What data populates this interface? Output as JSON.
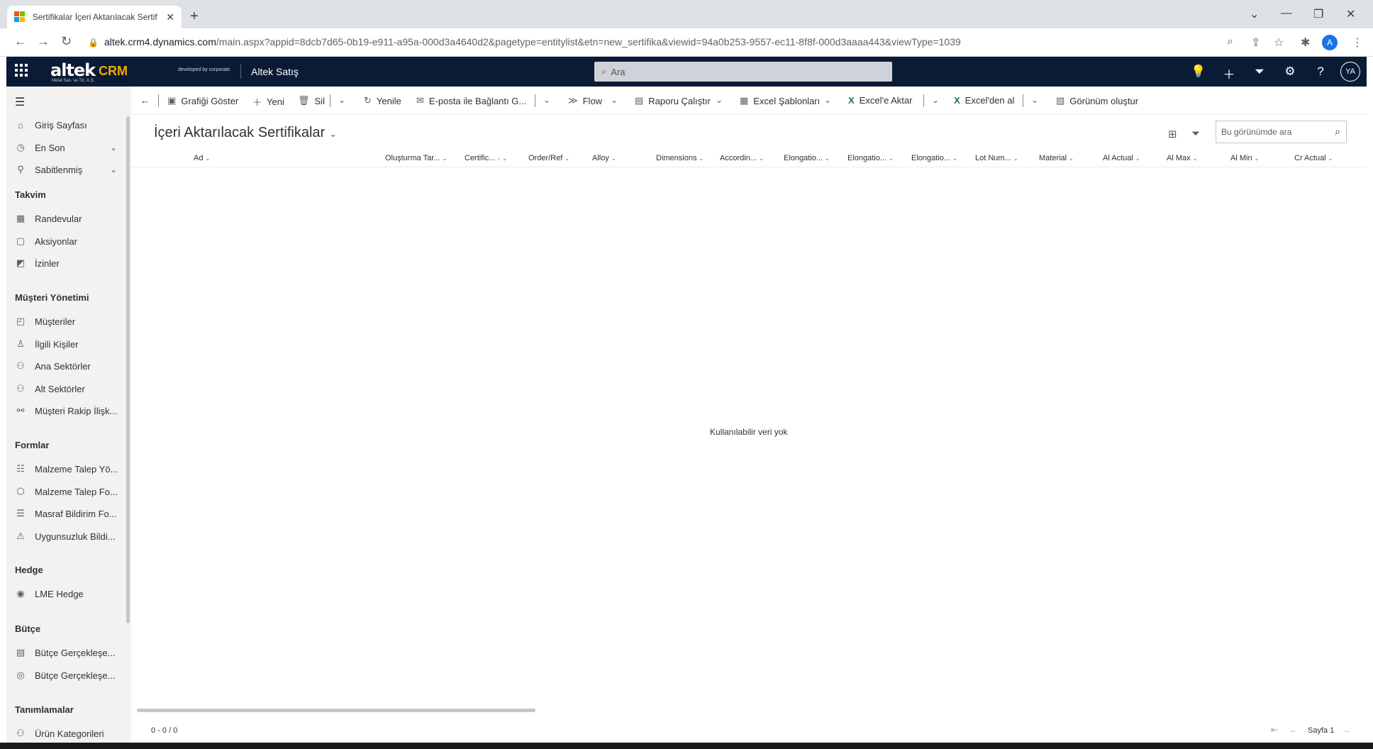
{
  "browser": {
    "tab_title": "Sertifikalar İçeri Aktarılacak Sertifikalar",
    "url_host": "altek.crm4.dynamics.com",
    "url_path": "/main.aspx?appid=8dcb7d65-0b19-e911-a95a-000d3a4640d2&pagetype=entitylist&etn=new_sertifika&viewid=94a0b253-9557-ec11-8f8f-000d3aaaa443&viewType=1039",
    "profile_initial": "A"
  },
  "header": {
    "logo": "altek",
    "logo_crm": "CRM",
    "logo_sub": "Metal San. ve Tic. A.Ş.",
    "developed_by": "developed by corporate",
    "app_name": "Altek Satış",
    "search_placeholder": "Ara",
    "avatar": "YA"
  },
  "sidebar": {
    "items_top": [
      {
        "label": "Giriş Sayfası",
        "icon": "home-icon"
      },
      {
        "label": "En Son",
        "icon": "clock-icon"
      },
      {
        "label": "Sabitlenmiş",
        "icon": "pin-icon"
      }
    ],
    "groups": [
      {
        "title": "Takvim",
        "items": [
          {
            "label": "Randevular",
            "icon": "calendar-icon"
          },
          {
            "label": "Aksiyonlar",
            "icon": "task-icon"
          },
          {
            "label": "İzinler",
            "icon": "leave-icon"
          }
        ]
      },
      {
        "title": "Müşteri Yönetimi",
        "items": [
          {
            "label": "Müşteriler",
            "icon": "customer-icon"
          },
          {
            "label": "İlgili Kişiler",
            "icon": "person-icon"
          },
          {
            "label": "Ana Sektörler",
            "icon": "sector-icon"
          },
          {
            "label": "Alt Sektörler",
            "icon": "subsector-icon"
          },
          {
            "label": "Müşteri Rakip İlişk...",
            "icon": "relation-icon"
          }
        ]
      },
      {
        "title": "Formlar",
        "items": [
          {
            "label": "Malzeme Talep Yö...",
            "icon": "list-icon"
          },
          {
            "label": "Malzeme Talep Fo...",
            "icon": "cube-icon"
          },
          {
            "label": "Masraf Bildirim Fo...",
            "icon": "bullets-icon"
          },
          {
            "label": "Uygunsuzluk Bildi...",
            "icon": "warning-icon"
          }
        ]
      },
      {
        "title": "Hedge",
        "items": [
          {
            "label": "LME Hedge",
            "icon": "hedge-icon"
          }
        ]
      },
      {
        "title": "Bütçe",
        "items": [
          {
            "label": "Bütçe Gerçekleşe...",
            "icon": "budget-icon"
          },
          {
            "label": "Bütçe Gerçekleşe...",
            "icon": "budget-circle-icon"
          }
        ]
      },
      {
        "title": "Tanımlamalar",
        "items": [
          {
            "label": "Ürün Kategorileri",
            "icon": "category-icon"
          }
        ]
      }
    ]
  },
  "commands": {
    "show_chart": "Grafiği Göster",
    "new": "Yeni",
    "delete": "Sil",
    "refresh": "Yenile",
    "email_link": "E-posta ile Bağlantı G...",
    "flow": "Flow",
    "run_report": "Raporu Çalıştır",
    "excel_templates": "Excel Şablonları",
    "export_excel": "Excel'e Aktar",
    "import_excel": "Excel'den al",
    "create_view": "Görünüm oluştur"
  },
  "view": {
    "title": "İçeri Aktarılacak Sertifikalar",
    "search_placeholder": "Bu görünümde ara",
    "columns": [
      "Ad",
      "Oluşturma Tar...",
      "Certific...",
      "Order/Ref",
      "Alloy",
      "Dimensions",
      "Accordin...",
      "Elongatio...",
      "Elongatio...",
      "Elongatio...",
      "Lot Num...",
      "Material",
      "Al Actual",
      "Al Max",
      "Al Min",
      "Cr Actual"
    ],
    "empty_message": "Kullanılabilir veri yok",
    "record_count": "0 - 0 / 0",
    "page_label": "Sayfa 1"
  }
}
